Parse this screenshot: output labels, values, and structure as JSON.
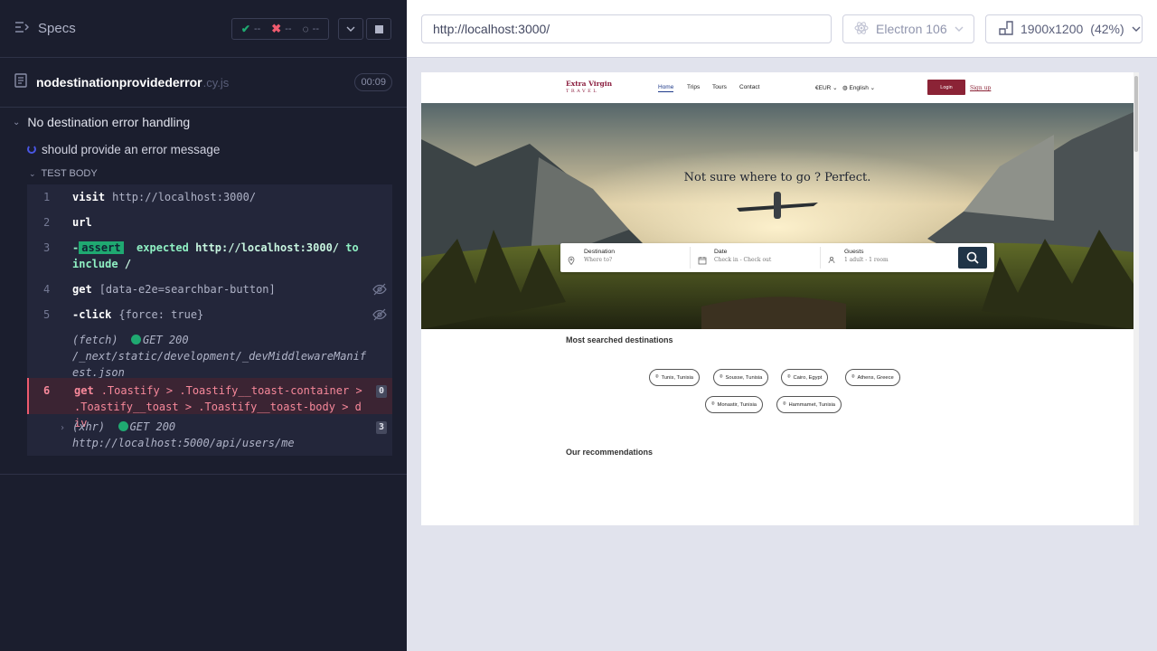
{
  "reporter": {
    "specs_label": "Specs",
    "stats": {
      "passed": "--",
      "failed": "--",
      "pending": "--"
    },
    "spec_name": "nodestinationprovidederror",
    "spec_ext": ".cy.js",
    "duration": "00:09",
    "suite_title": "No destination error handling",
    "test_title": "should provide an error message",
    "test_body_label": "TEST BODY",
    "commands": [
      {
        "num": "1",
        "name": "visit",
        "msg": "http://localhost:3000/"
      },
      {
        "num": "2",
        "name": "url",
        "msg": ""
      },
      {
        "num": "3",
        "name": "-assert",
        "badge": "assert",
        "expected": "expected",
        "url": "http://localhost:3000/",
        "to_include": "to",
        "include": "include",
        "slash": "/"
      },
      {
        "num": "4",
        "name": "get",
        "msg": "[data-e2e=searchbar-button]"
      },
      {
        "num": "5",
        "name": "-click",
        "msg": "{force: true}"
      },
      {
        "num": "",
        "name": "(fetch)",
        "status": "GET 200",
        "msg": "/_next/static/development/_devMiddlewareManifest.json"
      },
      {
        "num": "6",
        "name": "get",
        "msg": ".Toastify > .Toastify__toast-container > .Toastify__toast > .Toastify__toast-body > div",
        "count": "0"
      },
      {
        "num": "",
        "name": "(xhr)",
        "status": "GET 200",
        "msg": "http://localhost:5000/api/users/me",
        "count": "3"
      }
    ]
  },
  "aut": {
    "url": "http://localhost:3000/",
    "browser": "Electron 106",
    "viewport": "1900x1200",
    "scale": "(42%)"
  },
  "site": {
    "logo_main": "Extra Virgin",
    "logo_sub": "TRAVEL",
    "nav": [
      "Home",
      "Trips",
      "Tours",
      "Contact"
    ],
    "currency": "€EUR",
    "language": "English",
    "login": "Login",
    "signup": "Sign up",
    "hero_title": "Not sure where to go ? Perfect.",
    "search": {
      "destination_label": "Destination",
      "destination_hint": "Where to?",
      "date_label": "Date",
      "date_hint": "Check in - Check out",
      "guests_label": "Guests",
      "guests_hint": "1 adult - 1 room"
    },
    "most_searched_title": "Most searched destinations",
    "destinations": [
      "Tunis, Tunisia",
      "Sousse, Tunisia",
      "Cairo, Egypt",
      "Athens, Greece",
      "Monastir, Tunisia",
      "Hammamet, Tunisia"
    ],
    "recommendations_title": "Our recommendations"
  }
}
